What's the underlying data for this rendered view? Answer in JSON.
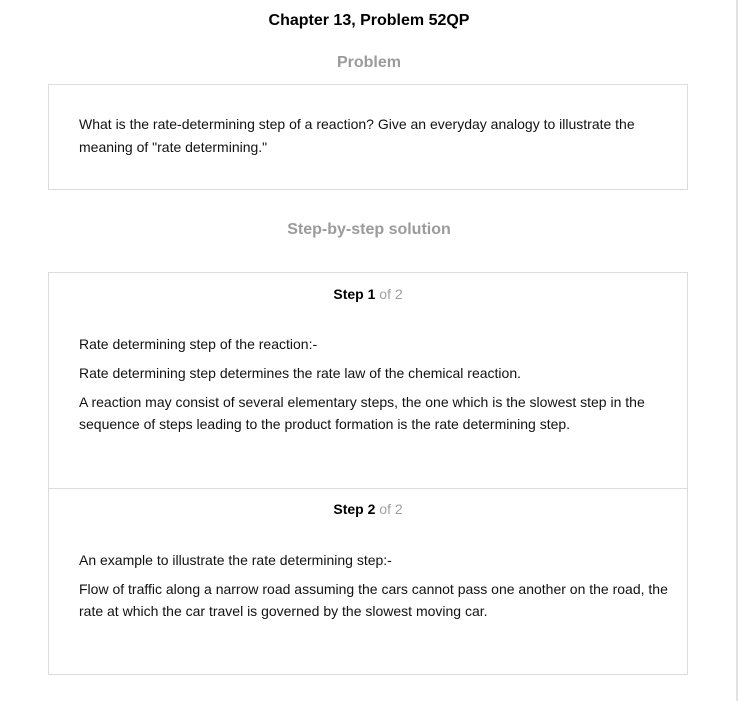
{
  "page": {
    "title": "Chapter 13, Problem 52QP"
  },
  "problem": {
    "heading": "Problem",
    "text": "What is the rate-determining step of a reaction? Give an everyday analogy to illustrate the meaning of \"rate determining.\""
  },
  "solution": {
    "heading": "Step-by-step solution",
    "steps": [
      {
        "word": "Step",
        "number": "1",
        "of": "of 2",
        "paragraphs": [
          "Rate determining step of the reaction:-",
          "Rate determining step determines the rate law of the chemical reaction.",
          "A reaction may consist of several elementary steps, the one which is the slowest step in the sequence of steps leading to the product formation is the rate determining step."
        ]
      },
      {
        "word": "Step",
        "number": "2",
        "of": "of 2",
        "paragraphs": [
          "An example to illustrate the rate determining step:-",
          "Flow of traffic along a narrow road assuming the cars cannot pass one another on the road, the rate at which the car travel is governed by the slowest moving car."
        ]
      }
    ]
  }
}
